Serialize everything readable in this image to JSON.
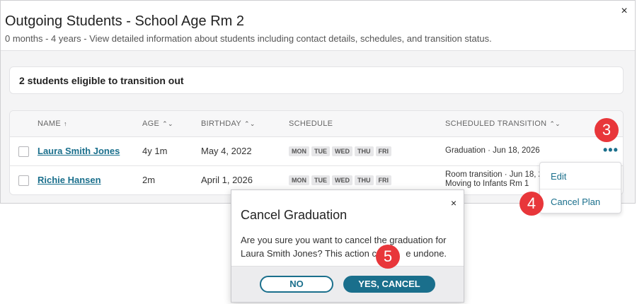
{
  "modal": {
    "title": "Outgoing Students - School Age Rm 2",
    "subtitle": "0 months - 4 years - View detailed information about students including contact details, schedules, and transition status.",
    "close_icon": "×"
  },
  "summary": {
    "text": "2 students eligible to transition out"
  },
  "table": {
    "headers": {
      "name": "NAME",
      "age": "AGE",
      "birthday": "BIRTHDAY",
      "schedule": "SCHEDULE",
      "transition": "SCHEDULED TRANSITION"
    },
    "sort_icons": {
      "asc": "↑",
      "both": "⌃⌄"
    },
    "rows": [
      {
        "name": "Laura Smith Jones",
        "age": "4y 1m",
        "birthday": "May 4, 2022",
        "days": [
          "MON",
          "TUE",
          "WED",
          "THU",
          "FRI"
        ],
        "transition_line1": "Graduation · Jun 18, 2026",
        "transition_line2": ""
      },
      {
        "name": "Richie Hansen",
        "age": "2m",
        "birthday": "April 1, 2026",
        "days": [
          "MON",
          "TUE",
          "WED",
          "THU",
          "FRI"
        ],
        "transition_line1": "Room transition · Jun 18, 20",
        "transition_line2": "Moving to Infants Rm 1"
      }
    ],
    "more_icon": "•••"
  },
  "dropdown": {
    "items": [
      "Edit",
      "Cancel Plan"
    ]
  },
  "dialog": {
    "title": "Cancel Graduation",
    "close_icon": "×",
    "body_line1": "Are you sure you want to cancel the graduation for",
    "body_line2": "Laura Smith Jones? This action ca",
    "body_line3": "e undone.",
    "no_label": "NO",
    "yes_label": "YES, CANCEL"
  },
  "steps": [
    "3",
    "4",
    "5"
  ],
  "colors": {
    "accent": "#1a6f8c",
    "step_badge": "#e8363a"
  }
}
